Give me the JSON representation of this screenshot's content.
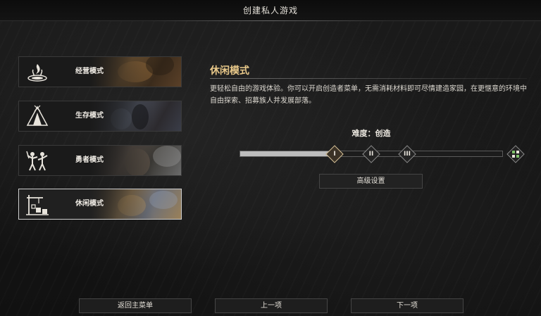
{
  "window": {
    "title": "创建私人游戏"
  },
  "modes": [
    {
      "label": "经营模式",
      "icon": "campfire-icon",
      "selected": false
    },
    {
      "label": "生存模式",
      "icon": "tent-icon",
      "selected": false
    },
    {
      "label": "勇者模式",
      "icon": "warriors-icon",
      "selected": false
    },
    {
      "label": "休闲模式",
      "icon": "building-icon",
      "selected": true
    }
  ],
  "detail": {
    "title": "休闲模式",
    "description": "更轻松自由的游戏体验。你可以开启创造者菜单，无需消耗材料即可尽情建造家园，在更惬意的环境中自由探索、招募族人并发展部落。",
    "difficulty_label": "难度：创造",
    "difficulty_levels": [
      {
        "glyph": "I",
        "active": true
      },
      {
        "glyph": "II",
        "active": false
      },
      {
        "glyph": "III",
        "active": false
      },
      {
        "glyph": "custom-grid-icon",
        "active": false
      }
    ],
    "advanced_settings": "高级设置"
  },
  "footer": {
    "back_to_menu": "返回主菜单",
    "previous": "上一项",
    "next": "下一项"
  },
  "colors": {
    "accent_title": "#e9c98a",
    "active_marker": "#d8c39a",
    "text": "#e8e4dc",
    "background": "#141414"
  }
}
